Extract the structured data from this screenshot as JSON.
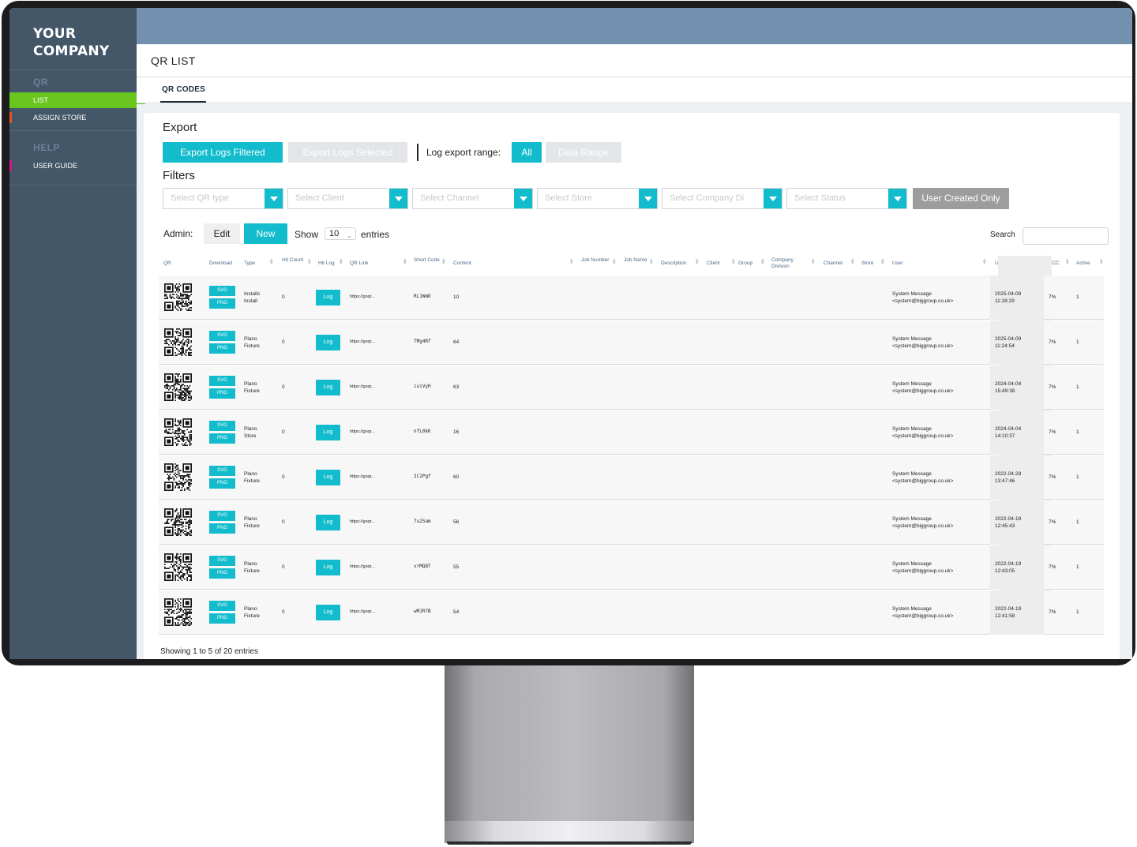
{
  "sidebar": {
    "brand": "YOUR\nCOMPANY",
    "brand_line1": "YOUR",
    "brand_line2": "COMPANY",
    "sections": [
      {
        "title": "QR",
        "items": [
          {
            "label": "LIST",
            "active": true
          },
          {
            "label": "ASSIGN STORE",
            "marker_color": "#e8531f"
          }
        ]
      },
      {
        "title": "HELP",
        "items": [
          {
            "label": "USER GUIDE",
            "marker_color": "#d6168b"
          }
        ]
      }
    ]
  },
  "header": {
    "title": "QR LIST"
  },
  "tabs": [
    {
      "label": "QR CODES",
      "active": true
    }
  ],
  "export": {
    "heading": "Export",
    "export_filtered": "Export Logs Filtered",
    "export_selected": "Export Logs Selected",
    "range_label": "Log export range:",
    "range_all": "All",
    "range_date": "Data Range"
  },
  "filters": {
    "heading": "Filters",
    "selects": [
      "Select QR type",
      "Select Client",
      "Select Channel",
      "Select Store",
      "Select Company Di",
      "Select Status"
    ],
    "user_created_only": "User Created Only"
  },
  "admin": {
    "label": "Admin:",
    "edit": "Edit",
    "new": "New",
    "show_label": "Show",
    "show_value": "10",
    "entries_label": "entries",
    "search_label": "Search",
    "search_value": ""
  },
  "table": {
    "columns": [
      "QR",
      "Download",
      "Type",
      "Hit Count",
      "Hit Log",
      "QR Link",
      "Short Code",
      "Content",
      "Job Number",
      "Job Name",
      "Description",
      "Client",
      "Group",
      "Company Division",
      "Channel",
      "Store",
      "User",
      "Updated",
      "ECC",
      "Active"
    ],
    "download_svg": "SVG",
    "download_png": "PNG",
    "log_label": "Log",
    "rows": [
      {
        "type": [
          "Installs",
          "Install"
        ],
        "hit_count": "0",
        "qr_link": "https://goqr...",
        "short_code": "RL1WmD",
        "content": "10",
        "user": [
          "System Message",
          "<system@biggroup.co.uk>"
        ],
        "updated": [
          "2025-04-09",
          "11:28:29"
        ],
        "ecc": "7%",
        "active": "1"
      },
      {
        "type": [
          "Plano",
          "Fixture"
        ],
        "hit_count": "0",
        "qr_link": "https://goqr...",
        "short_code": "TMg4Rf",
        "content": "64",
        "user": [
          "System Message",
          "<system@biggroup.co.uk>"
        ],
        "updated": [
          "2025-04-09",
          "11:24:54"
        ],
        "ecc": "7%",
        "active": "1"
      },
      {
        "type": [
          "Plano",
          "Fixture"
        ],
        "hit_count": "0",
        "qr_link": "https://goqr...",
        "short_code": "iuiVyH",
        "content": "63",
        "user": [
          "System Message",
          "<system@biggroup.co.uk>"
        ],
        "updated": [
          "2024-04-04",
          "15:49:38"
        ],
        "ecc": "7%",
        "active": "1"
      },
      {
        "type": [
          "Plano",
          "Store"
        ],
        "hit_count": "0",
        "qr_link": "https://goqr...",
        "short_code": "nfL0kK",
        "content": "16",
        "user": [
          "System Message",
          "<system@biggroup.co.uk>"
        ],
        "updated": [
          "2024-04-04",
          "14:10:37"
        ],
        "ecc": "7%",
        "active": "1"
      },
      {
        "type": [
          "Plano",
          "Fixture"
        ],
        "hit_count": "0",
        "qr_link": "https://goqr...",
        "short_code": "2C2Pgf",
        "content": "60",
        "user": [
          "System Message",
          "<system@biggroup.co.uk>"
        ],
        "updated": [
          "2022-04-28",
          "13:47:46"
        ],
        "ecc": "7%",
        "active": "1"
      },
      {
        "type": [
          "Plano",
          "Fixture"
        ],
        "hit_count": "0",
        "qr_link": "https://goqr...",
        "short_code": "7u25am",
        "content": "56",
        "user": [
          "System Message",
          "<system@biggroup.co.uk>"
        ],
        "updated": [
          "2022-04-19",
          "12:45:43"
        ],
        "ecc": "7%",
        "active": "1"
      },
      {
        "type": [
          "Plano",
          "Fixture"
        ],
        "hit_count": "0",
        "qr_link": "https://goqr...",
        "short_code": "vrMQ8T",
        "content": "55",
        "user": [
          "System Message",
          "<system@biggroup.co.uk>"
        ],
        "updated": [
          "2022-04-19",
          "12:43:05"
        ],
        "ecc": "7%",
        "active": "1"
      },
      {
        "type": [
          "Plano",
          "Fixture"
        ],
        "hit_count": "0",
        "qr_link": "https://goqr...",
        "short_code": "wMJR7B",
        "content": "54",
        "user": [
          "System Message",
          "<system@biggroup.co.uk>"
        ],
        "updated": [
          "2022-04-19",
          "12:41:58"
        ],
        "ecc": "7%",
        "active": "1"
      }
    ]
  },
  "footer": {
    "showing": "Showing 1 to 5 of 20 entries"
  },
  "colors": {
    "sidebar": "#445769",
    "topbar": "#7390ae",
    "accent": "#12bccc",
    "active_nav": "#69c51e"
  }
}
